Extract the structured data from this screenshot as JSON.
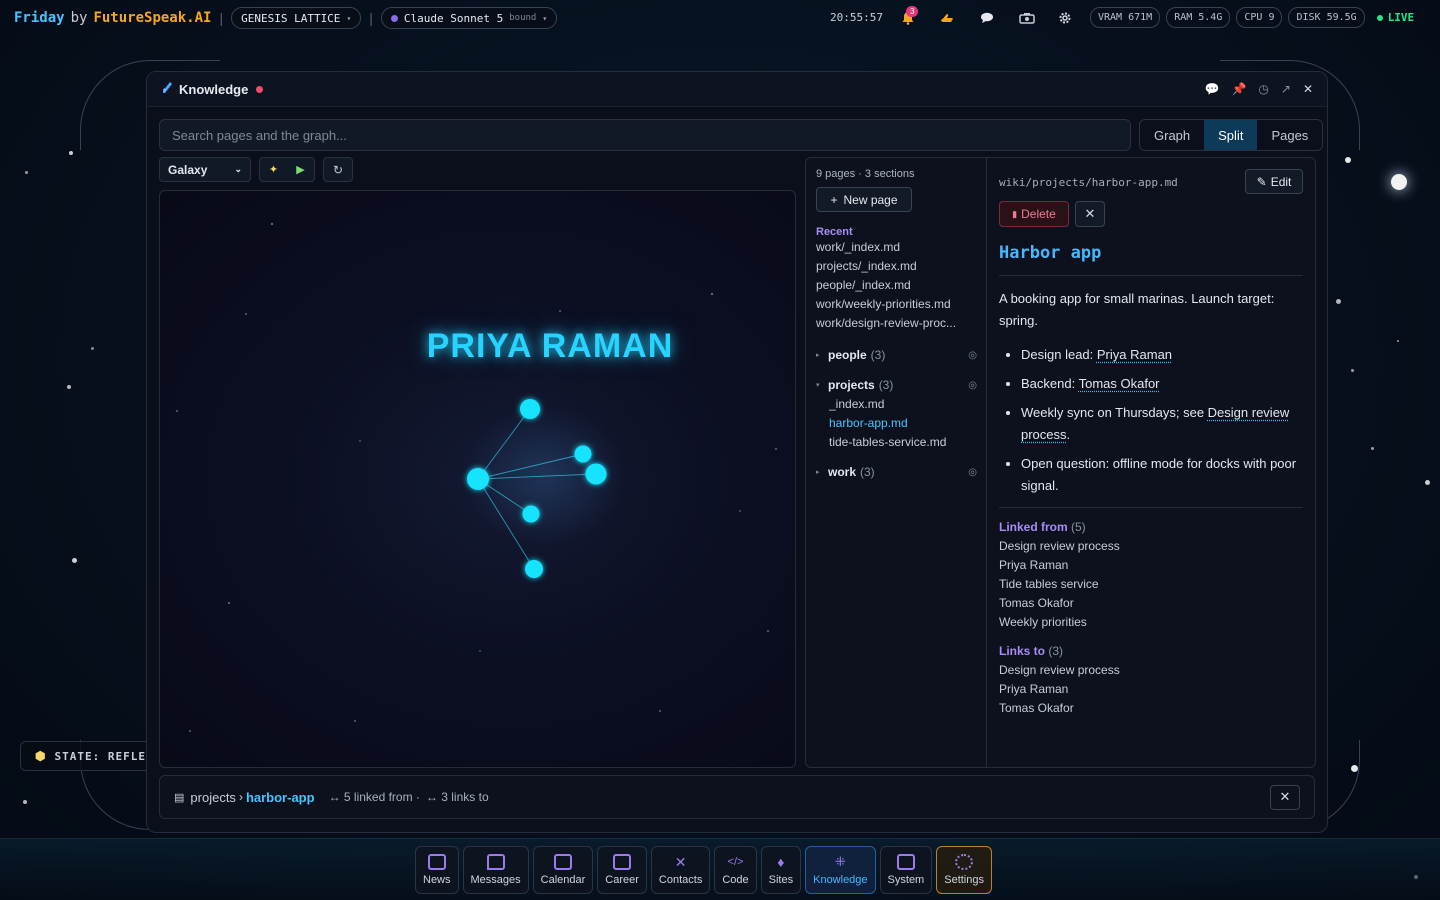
{
  "topbar": {
    "brand_name": "Friday",
    "brand_by": "by",
    "brand_company": "FutureSpeak.AI",
    "workspace": "GENESIS LATTICE",
    "model_name": "Claude Sonnet 5",
    "model_status": "bound",
    "clock": "20:55:57",
    "notification_count": "3",
    "metrics": {
      "vram": "VRAM 671M",
      "ram": "RAM 5.4G",
      "cpu": "CPU 9",
      "disk": "DISK 59.5G"
    },
    "live": "LIVE"
  },
  "window": {
    "title": "Knowledge",
    "search_placeholder": "Search pages and the graph...",
    "view_tabs": [
      "Graph",
      "Split",
      "Pages"
    ],
    "active_view": "Split"
  },
  "graph": {
    "layout_select": "Galaxy",
    "focus_label": "PRIYA RAMAN"
  },
  "pages": {
    "meta": "9 pages · 3 sections",
    "new_page_label": "New page",
    "recent_heading": "Recent",
    "recent": [
      "work/_index.md",
      "projects/_index.md",
      "people/_index.md",
      "work/weekly-priorities.md",
      "work/design-review-proc..."
    ],
    "groups": [
      {
        "name": "people",
        "count": "(3)"
      },
      {
        "name": "projects",
        "count": "(3)",
        "files": [
          "_index.md",
          "harbor-app.md",
          "tide-tables-service.md"
        ]
      },
      {
        "name": "work",
        "count": "(3)"
      }
    ]
  },
  "detail": {
    "path": "wiki/projects/harbor-app.md",
    "edit_label": "Edit",
    "delete_label": "Delete",
    "title": "Harbor app",
    "summary": "A booking app for small marinas. Launch target: spring.",
    "bullets": [
      {
        "prefix": "Design lead: ",
        "link": "Priya Raman",
        "suffix": ""
      },
      {
        "prefix": "Backend: ",
        "link": "Tomas Okafor",
        "suffix": ""
      },
      {
        "prefix": "Weekly sync on Thursdays; see ",
        "link": "Design review process",
        "suffix": "."
      },
      {
        "prefix": "Open question: offline mode for docks with poor signal.",
        "link": "",
        "suffix": ""
      }
    ],
    "linked_from_heading": "Linked from",
    "linked_from_count": "(5)",
    "linked_from": [
      "Design review process",
      "Priya Raman",
      "Tide tables service",
      "Tomas Okafor",
      "Weekly priorities"
    ],
    "links_to_heading": "Links to",
    "links_to_count": "(3)",
    "links_to": [
      "Design review process",
      "Priya Raman",
      "Tomas Okafor"
    ]
  },
  "statusbar": {
    "section": "projects",
    "slug": "harbor-app",
    "linked_from_text": "↔ 5 linked from ·",
    "links_to_text": "↔ 3 links to"
  },
  "state_label": "STATE: REFLE",
  "dock": [
    "News",
    "Messages",
    "Calendar",
    "Career",
    "Contacts",
    "Code",
    "Sites",
    "Knowledge",
    "System",
    "Settings"
  ],
  "dock_active": "Knowledge"
}
